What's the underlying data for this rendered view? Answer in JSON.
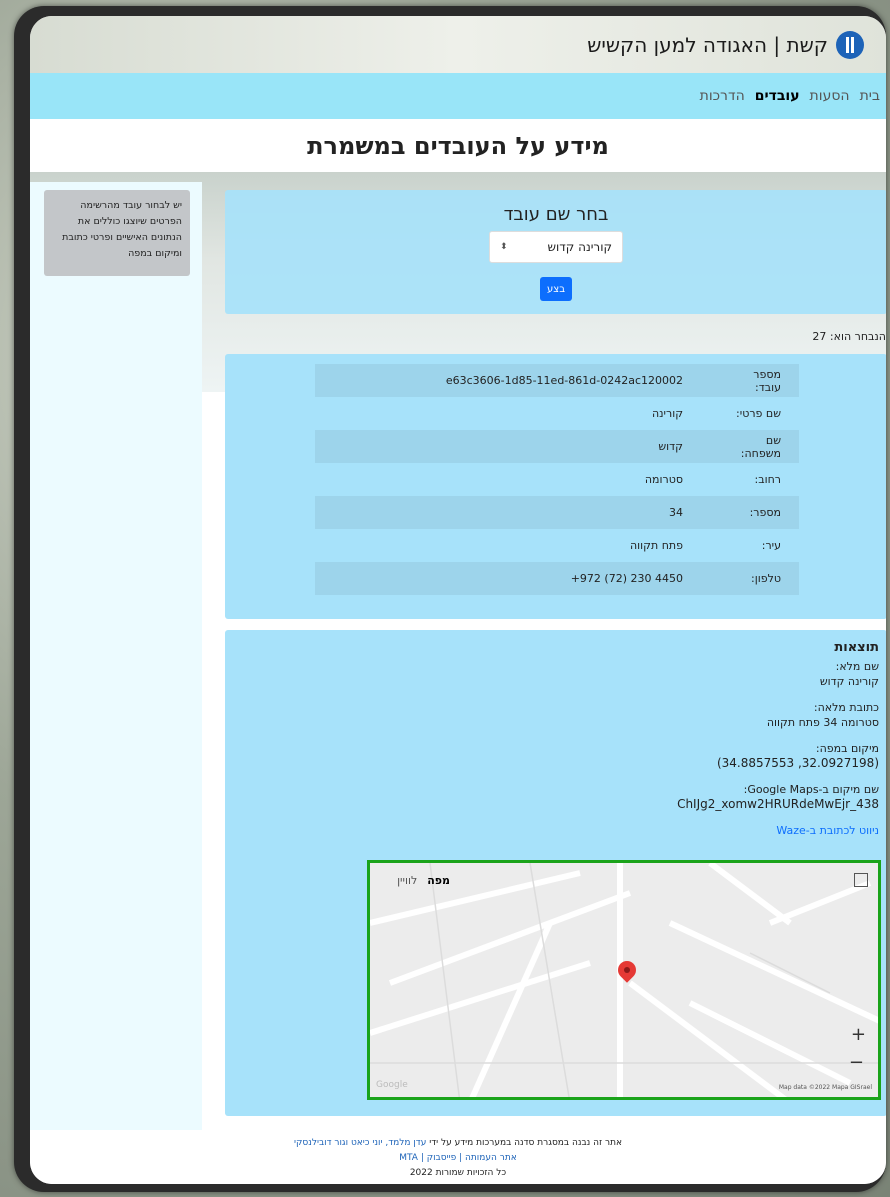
{
  "header": {
    "brand": "קשת | האגודה למען הקשיש"
  },
  "nav": {
    "items": [
      "בית",
      "הסעות",
      "עובדים",
      "הדרכות"
    ]
  },
  "page": {
    "title": "מידע על העובדים במשמרת"
  },
  "sidebar": {
    "hint": "יש לבחור עובד מהרשימה הפרטים שיוצגו כוללים את הנתונים האישיים ופרטי כתובת ומיקום במפה"
  },
  "form": {
    "title": "בחר שם עובד",
    "selected_value": "קורינה קדוש",
    "submit_label": "בצע",
    "selected_note": "הנבחר הוא: 27"
  },
  "details": {
    "rows": [
      {
        "label": "מספר עובד:",
        "value": "e63c3606-1d85-11ed-861d-0242ac120002"
      },
      {
        "label": "שם פרטי:",
        "value": "קורינה"
      },
      {
        "label": "שם משפחה:",
        "value": "קדוש"
      },
      {
        "label": "רחוב:",
        "value": "סטרומה"
      },
      {
        "label": "מספר:",
        "value": "34"
      },
      {
        "label": "עיר:",
        "value": "פתח תקווה"
      },
      {
        "label": "טלפון:",
        "value": "+972 (72) 230 4450"
      }
    ]
  },
  "results": {
    "title": "תוצאות",
    "full_name_label": "שם מלא:",
    "full_name": "קורינה קדוש",
    "address_label": "כתובת מלאה:",
    "address": "סטרומה 34 פתח תקווה",
    "location_label": "מיקום במפה:",
    "location": "(34.8857553 ,32.0927198)",
    "gmaps_label": "שם מיקום ב-Google Maps:",
    "gmaps_value": "ChIJg2_xomw2HRURdeMwEjr_438",
    "waze_link": "ניווט לכתובת ב-Waze"
  },
  "map": {
    "tab_map": "מפה",
    "tab_satellite": "לוויין",
    "attribution": "Map data ©2022 Mapa GISrael",
    "google": "Google"
  },
  "footer": {
    "line1_prefix": "אתר זה נבנה במסגרת סדנה במערכות מידע על ידי ",
    "authors": "עדן מלמד, יוני כיאט וגור דובילנסקי",
    "links": "אתר העמותה | פייסבוק | MTA",
    "copyright": "כל הזכויות שמורות 2022"
  }
}
